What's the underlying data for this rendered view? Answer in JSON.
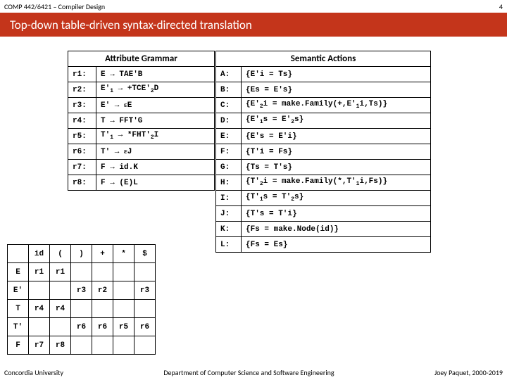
{
  "header": {
    "course": "COMP 442/6421 – Compiler Design",
    "page": "4"
  },
  "title": "Top-down table-driven syntax-directed translation",
  "attrHeader": "Attribute Grammar",
  "semHeader": "Semantic Actions",
  "attr": [
    {
      "r": "r1:",
      "p": "E → TAE'B"
    },
    {
      "r": "r2:",
      "p": "E'₁ → +TCE'₂D"
    },
    {
      "r": "r3:",
      "p": "E' → εE"
    },
    {
      "r": "r4:",
      "p": "T → FFT'G"
    },
    {
      "r": "r5:",
      "p": "T'₁ → *FHT'₂I"
    },
    {
      "r": "r6:",
      "p": "T' → εJ"
    },
    {
      "r": "r7:",
      "p": "F → id.K"
    },
    {
      "r": "r8:",
      "p": "F → (E)L"
    }
  ],
  "sem": [
    {
      "k": "A:",
      "v": "{E'i = Ts}"
    },
    {
      "k": "B:",
      "v": "{Es  = E's}"
    },
    {
      "k": "C:",
      "v": "{E'₂i = make.Family(+,E'₁i,Ts)}"
    },
    {
      "k": "D:",
      "v": "{E'₁s = E'₂s}"
    },
    {
      "k": "E:",
      "v": "{E's = E'i}"
    },
    {
      "k": "F:",
      "v": "{T'i = Fs}"
    },
    {
      "k": "G:",
      "v": "{Ts = T's}"
    },
    {
      "k": "H:",
      "v": "{T'₂i = make.Family(*,T'₁i,Fs)}"
    },
    {
      "k": "I:",
      "v": "{T'₁s = T'₂s}"
    },
    {
      "k": "J:",
      "v": "{T's = T'i}"
    },
    {
      "k": "K:",
      "v": "{Fs = make.Node(id)}"
    },
    {
      "k": "L:",
      "v": "{Fs = Es}"
    }
  ],
  "parse": {
    "cols": [
      "",
      "id",
      "(",
      ")",
      "+",
      "*",
      "$"
    ],
    "rows": [
      {
        "h": "E",
        "c": [
          "r1",
          "r1",
          "",
          "",
          "",
          ""
        ]
      },
      {
        "h": "E'",
        "c": [
          "",
          "",
          "r3",
          "r2",
          "",
          "r3"
        ]
      },
      {
        "h": "T",
        "c": [
          "r4",
          "r4",
          "",
          "",
          "",
          ""
        ]
      },
      {
        "h": "T'",
        "c": [
          "",
          "",
          "r6",
          "r6",
          "r5",
          "r6"
        ]
      },
      {
        "h": "F",
        "c": [
          "r7",
          "r8",
          "",
          "",
          "",
          ""
        ]
      }
    ]
  },
  "footer": {
    "left": "Concordia University",
    "mid": "Department of Computer Science and Software Engineering",
    "right": "Joey Paquet, 2000-2019"
  }
}
